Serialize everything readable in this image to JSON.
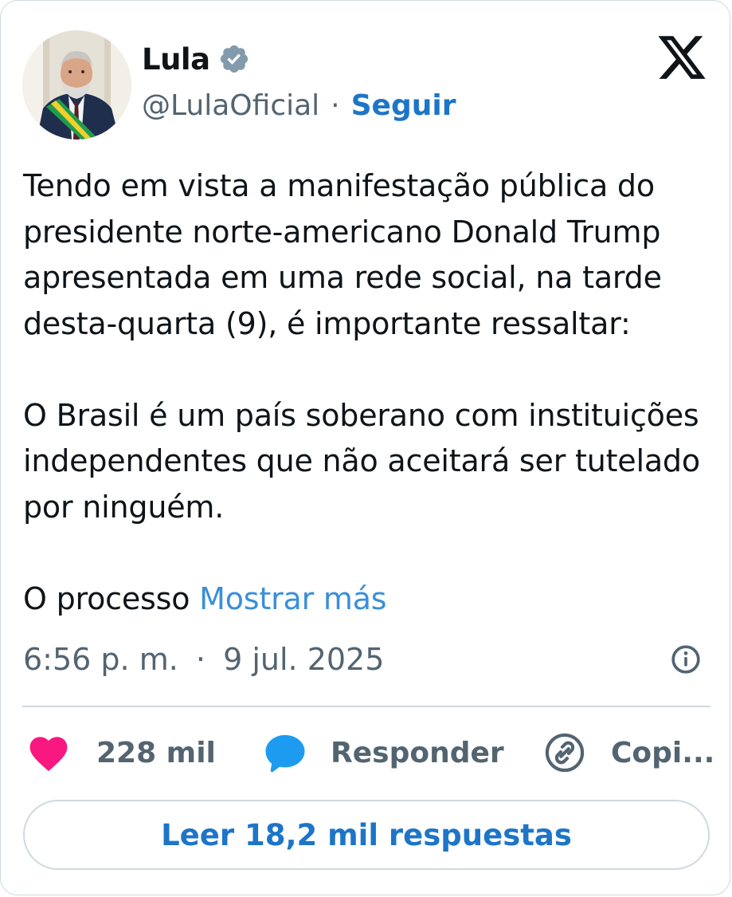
{
  "author": {
    "display_name": "Lula",
    "handle": "@LulaOficial",
    "separator": "·",
    "follow_label": "Seguir",
    "verified_color": "#829aab"
  },
  "brand": {
    "logo_icon": "x-logo-icon"
  },
  "tweet": {
    "paragraphs": [
      "Tendo em vista a manifestação pública do presidente norte-americano Donald Trump apresentada em uma rede social, na tarde desta-quarta (9), é importante ressaltar:",
      "O Brasil é um país soberano com instituições independentes que não aceitará ser tutelado por ninguém."
    ],
    "truncated_text": "O processo",
    "show_more_label": "Mostrar más"
  },
  "meta": {
    "time": "6:56 p. m.",
    "separator": "·",
    "date": "9 jul. 2025",
    "info_icon": "info-icon"
  },
  "actions": {
    "like_count": "228 mil",
    "reply_label": "Responder",
    "copy_label": "Copi...",
    "like_color": "#f91880",
    "reply_color": "#1d9bf0"
  },
  "replies_button": {
    "label": "Leer 18,2 mil respuestas"
  },
  "colors": {
    "accent": "#1d75c8",
    "muted": "#536471",
    "border": "#cfd9de"
  }
}
